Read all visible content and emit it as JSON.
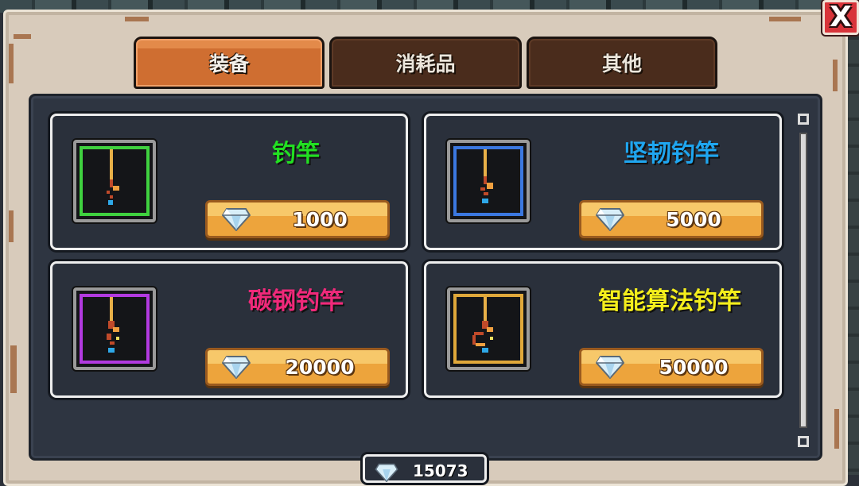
{
  "tabs": [
    {
      "label": "装备",
      "active": true
    },
    {
      "label": "消耗品",
      "active": false
    },
    {
      "label": "其他",
      "active": false
    }
  ],
  "items": [
    {
      "name": "钓竿",
      "name_color": "#22e022",
      "rarity_color": "#3fd13f",
      "price": "1000"
    },
    {
      "name": "坚韧钓竿",
      "name_color": "#1fa6f0",
      "rarity_color": "#3b78e0",
      "price": "5000"
    },
    {
      "name": "碳钢钓竿",
      "name_color": "#f0297a",
      "rarity_color": "#b23ae0",
      "price": "20000"
    },
    {
      "name": "智能算法钓竿",
      "name_color": "#f4ee1c",
      "rarity_color": "#e0a83a",
      "price": "50000"
    }
  ],
  "currency": {
    "icon": "diamond-icon",
    "amount": "15073"
  },
  "close": {
    "label": "X"
  }
}
